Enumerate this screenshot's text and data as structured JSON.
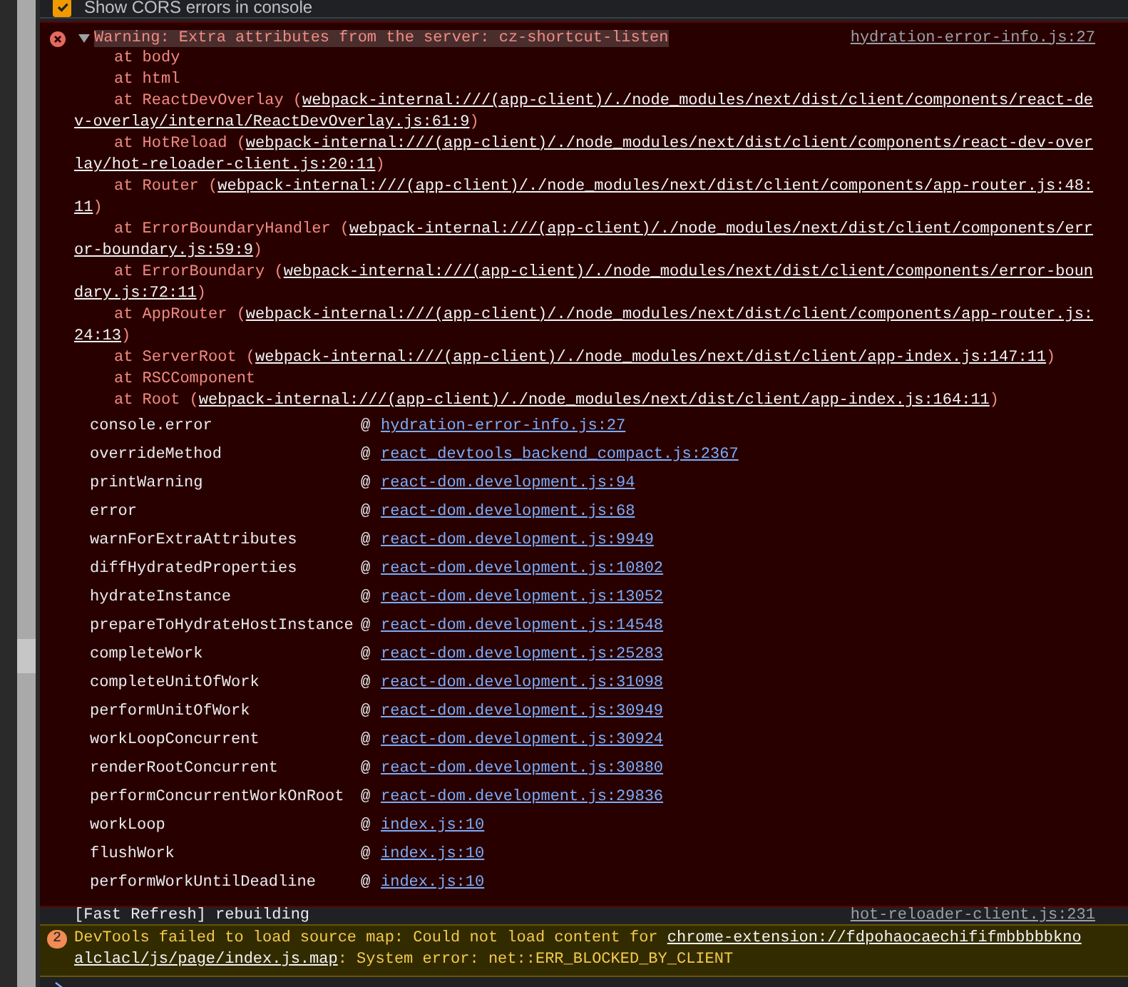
{
  "settings_row": {
    "label": "Show CORS errors in console",
    "checked": true
  },
  "error_message": {
    "expanded": true,
    "title": "Warning: Extra attributes from the server: cz-shortcut-listen",
    "source": "hydration-error-info.js:27",
    "trace": [
      {
        "text": "at body"
      },
      {
        "text": "at html"
      },
      {
        "text": "at ReactDevOverlay (",
        "link": [
          "webpack-internal:///(app-client)/./node_modules/next/dist/client/components/react-de",
          "v-overlay/internal/ReactDevOverlay.js:61:9"
        ],
        "after": ")"
      },
      {
        "text": "at HotReload (",
        "link": [
          "webpack-internal:///(app-client)/./node_modules/next/dist/client/components/react-dev-over",
          "lay/hot-reloader-client.js:20:11"
        ],
        "after": ")"
      },
      {
        "text": "at Router (",
        "link": [
          "webpack-internal:///(app-client)/./node_modules/next/dist/client/components/app-router.js:48:",
          "11"
        ],
        "after": ")"
      },
      {
        "text": "at ErrorBoundaryHandler (",
        "link": [
          "webpack-internal:///(app-client)/./node_modules/next/dist/client/components/err",
          "or-boundary.js:59:9"
        ],
        "after": ")"
      },
      {
        "text": "at ErrorBoundary (",
        "link": [
          "webpack-internal:///(app-client)/./node_modules/next/dist/client/components/error-boun",
          "dary.js:72:11"
        ],
        "after": ")"
      },
      {
        "text": "at AppRouter (",
        "link": [
          "webpack-internal:///(app-client)/./node_modules/next/dist/client/components/app-router.js:",
          "24:13"
        ],
        "after": ")"
      },
      {
        "text": "at ServerRoot (",
        "link": [
          "webpack-internal:///(app-client)/./node_modules/next/dist/client/app-index.js:147:11"
        ],
        "after": ")"
      },
      {
        "text": "at RSCComponent"
      },
      {
        "text": "at Root (",
        "link": [
          "webpack-internal:///(app-client)/./node_modules/next/dist/client/app-index.js:164:11"
        ],
        "after": ")"
      }
    ],
    "call_stack": [
      {
        "function": "console.error",
        "at": "@",
        "source": "hydration-error-info.js:27"
      },
      {
        "function": "overrideMethod",
        "at": "@",
        "source": "react_devtools_backend_compact.js:2367"
      },
      {
        "function": "printWarning",
        "at": "@",
        "source": "react-dom.development.js:94"
      },
      {
        "function": "error",
        "at": "@",
        "source": "react-dom.development.js:68"
      },
      {
        "function": "warnForExtraAttributes",
        "at": "@",
        "source": "react-dom.development.js:9949"
      },
      {
        "function": "diffHydratedProperties",
        "at": "@",
        "source": "react-dom.development.js:10802"
      },
      {
        "function": "hydrateInstance",
        "at": "@",
        "source": "react-dom.development.js:13052"
      },
      {
        "function": "prepareToHydrateHostInstance",
        "at": "@",
        "source": "react-dom.development.js:14548"
      },
      {
        "function": "completeWork",
        "at": "@",
        "source": "react-dom.development.js:25283"
      },
      {
        "function": "completeUnitOfWork",
        "at": "@",
        "source": "react-dom.development.js:31098"
      },
      {
        "function": "performUnitOfWork",
        "at": "@",
        "source": "react-dom.development.js:30949"
      },
      {
        "function": "workLoopConcurrent",
        "at": "@",
        "source": "react-dom.development.js:30924"
      },
      {
        "function": "renderRootConcurrent",
        "at": "@",
        "source": "react-dom.development.js:30880"
      },
      {
        "function": "performConcurrentWorkOnRoot",
        "at": "@",
        "source": "react-dom.development.js:29836"
      },
      {
        "function": "workLoop",
        "at": "@",
        "source": "index.js:10"
      },
      {
        "function": "flushWork",
        "at": "@",
        "source": "index.js:10"
      },
      {
        "function": "performWorkUntilDeadline",
        "at": "@",
        "source": "index.js:10"
      }
    ]
  },
  "log_message": {
    "text": "[Fast Refresh] rebuilding",
    "source": "hot-reloader-client.js:231"
  },
  "warning_message": {
    "count": "2",
    "text": "DevTools failed to load source map: Could not load content for ",
    "link": [
      "chrome-extension://fdpohaocaechififmbbbbbkno",
      "alclacl/js/page/index.js.map"
    ],
    "after": ": System error: net::ERR_BLOCKED_BY_CLIENT"
  }
}
